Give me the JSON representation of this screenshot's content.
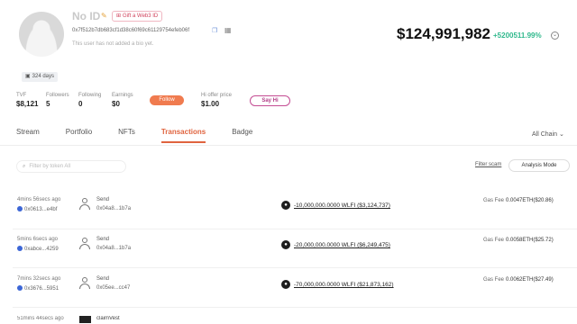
{
  "profile": {
    "name": "No ID",
    "gift_label": "Gift a Web3 ID",
    "address": "0x7f512b7db683cf1d38c60f69c61129754efeb06f",
    "bio": "This user has not added a bio yet.",
    "days": "324 days"
  },
  "balance": {
    "value": "$124,991,982",
    "change": "+5200511.99%"
  },
  "stats": {
    "tvf_label": "TVF",
    "tvf": "$8,121",
    "followers_label": "Followers",
    "followers": "5",
    "following_label": "Following",
    "following": "0",
    "earnings_label": "Earnings",
    "earnings": "$0",
    "follow_button": "Follow",
    "hi_label": "Hi offer price",
    "hi_price": "$1.00",
    "say_hi_button": "Say Hi"
  },
  "tabs": [
    "Stream",
    "Portfolio",
    "NFTs",
    "Transactions",
    "Badge"
  ],
  "active_tab": "Transactions",
  "chain_filter": "All Chain",
  "toolbar": {
    "search_placeholder": "Filter by token All",
    "filter_scam": "Filter scam",
    "analysis_mode": "Analysis Mode"
  },
  "transactions": [
    {
      "time": "4mins 56secs ago",
      "from": "0x0613...e4bf",
      "type": "Send",
      "to": "0x04a8...1b7a",
      "amount": "-10,000,000.0000 WLFI ($3,124,737)",
      "gas_label": "Gas Fee",
      "gas": "0.0047ETH($20.86)"
    },
    {
      "time": "5mins 6secs ago",
      "from": "0xabce...4259",
      "type": "Send",
      "to": "0x04a8...1b7a",
      "amount": "-20,000,000.0000 WLFI ($6,249,475)",
      "gas_label": "Gas Fee",
      "gas": "0.0058ETH($25.72)"
    },
    {
      "time": "7mins 32secs ago",
      "from": "0x3676...5951",
      "type": "Send",
      "to": "0x05ee...cc47",
      "amount": "-70,000,000.0000 WLFI ($21,873,162)",
      "gas_label": "Gas Fee",
      "gas": "0.0062ETH($27.49)"
    },
    {
      "time": "51mins 44secs ago",
      "type": "claimVest"
    }
  ],
  "icons": {
    "edit": "edit-icon",
    "copy": "copy-icon",
    "qr": "qr-code-icon",
    "calendar": "calendar-icon",
    "search": "search-icon",
    "chevron": "chevron-down-icon",
    "token": "wlfi-token-icon",
    "user": "user-icon"
  },
  "colors": {
    "accent": "#e0643f",
    "positive": "#2fb88c",
    "follow": "#f07b4f",
    "say_hi": "#b23d86"
  }
}
